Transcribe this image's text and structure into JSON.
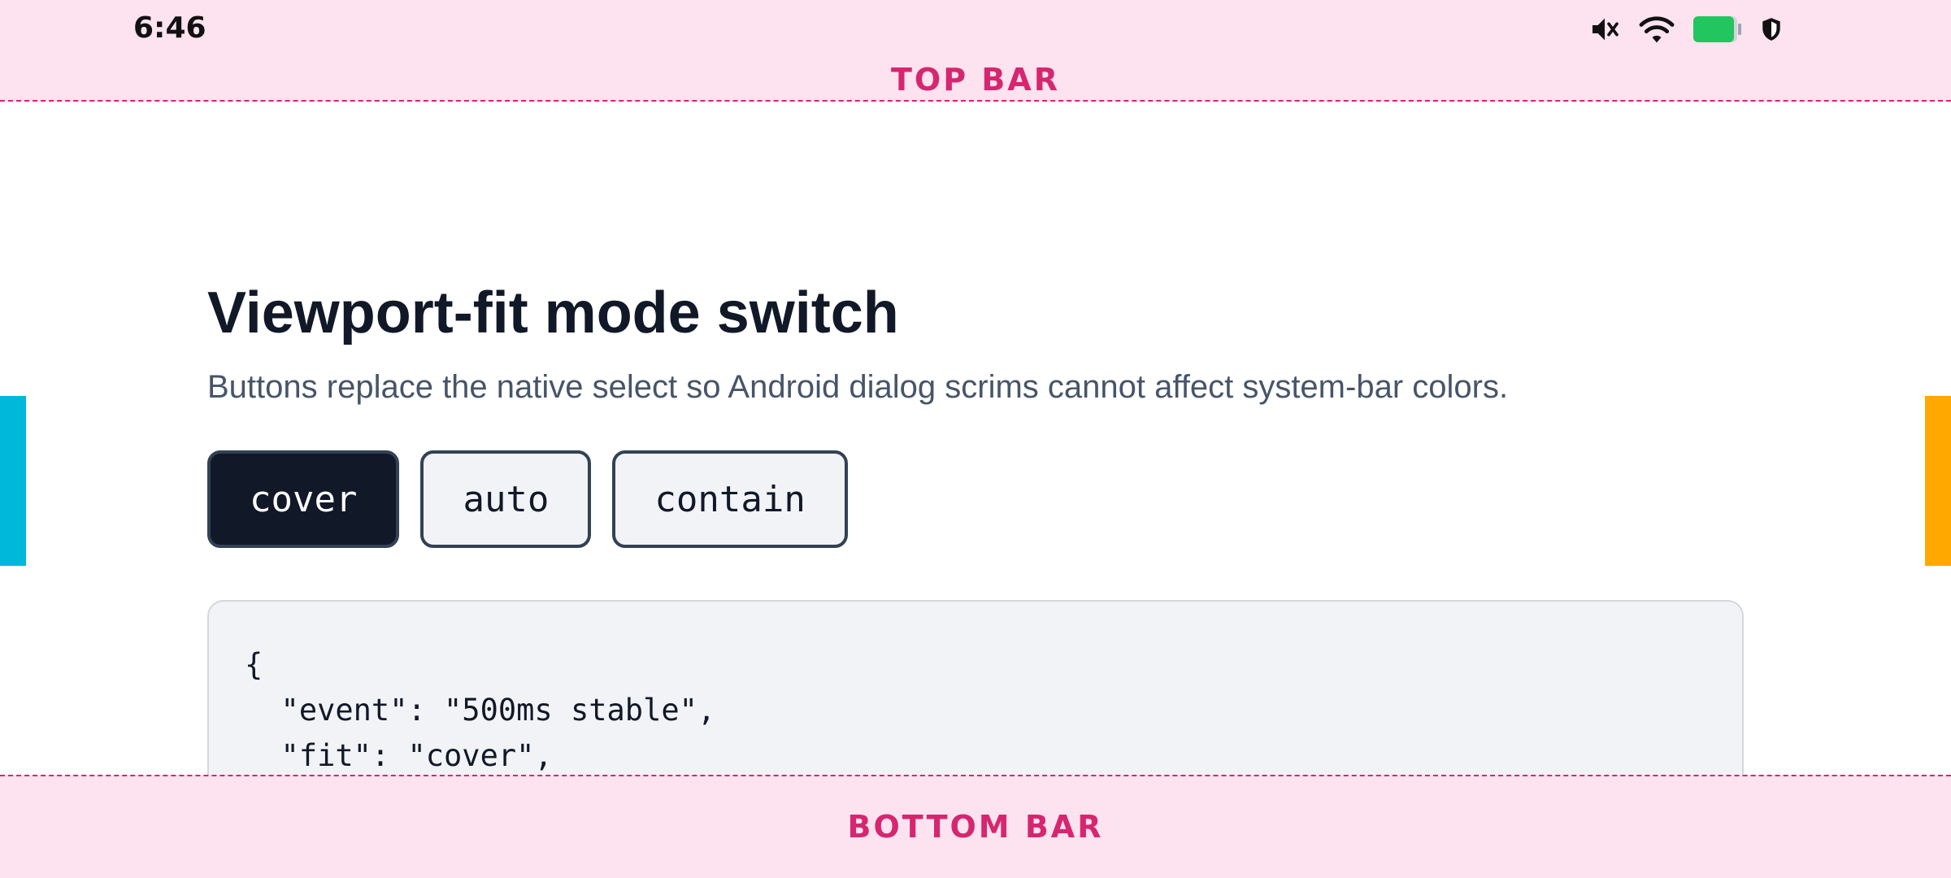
{
  "status_bar": {
    "time": "6:46",
    "icons": [
      "mute-icon",
      "wifi-icon",
      "battery-icon",
      "shield-icon"
    ],
    "battery_color": "#22c55e"
  },
  "top_bar": {
    "label": "TOP BAR"
  },
  "bottom_bar": {
    "label": "BOTTOM BAR"
  },
  "page": {
    "title": "Viewport-fit mode switch",
    "description": "Buttons replace the native select so Android dialog scrims cannot affect system-bar colors."
  },
  "mode_buttons": [
    {
      "label": "cover",
      "selected": true
    },
    {
      "label": "auto",
      "selected": false
    },
    {
      "label": "contain",
      "selected": false
    }
  ],
  "code_panel": {
    "lines": [
      "{",
      "  \"event\": \"500ms stable\",",
      "  \"fit\": \"cover\","
    ]
  },
  "colors": {
    "bar_background": "#fde2f0",
    "bar_accent": "#d6266f",
    "left_marker": "#00b8d9",
    "right_marker": "#ffa800",
    "active_button": "#111827"
  }
}
